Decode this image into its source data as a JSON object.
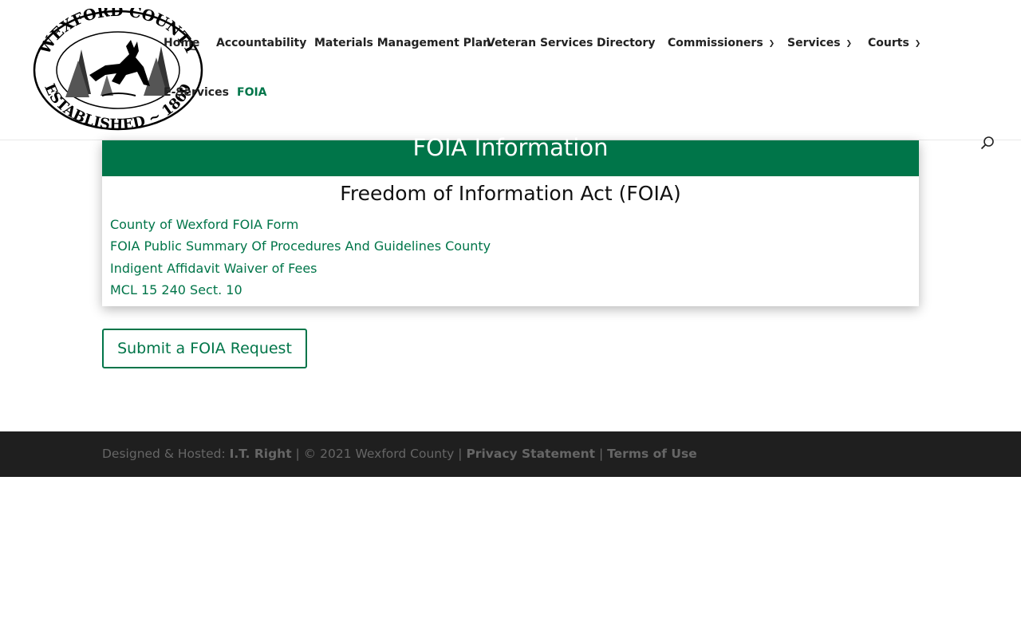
{
  "header": {
    "logo": {
      "top_text": "WEXFORD COUNTY",
      "bottom_text": "ESTABLISHED ~ 1869",
      "icon": "deer-seal-icon"
    },
    "nav": {
      "items": [
        {
          "label": "Home",
          "dropdown": false
        },
        {
          "label": "Accountability",
          "dropdown": false
        },
        {
          "label": "Materials Management Plan",
          "dropdown": false
        },
        {
          "label": "Veteran Services",
          "dropdown": false
        },
        {
          "label": "Directory",
          "dropdown": false
        },
        {
          "label": "Commissioners",
          "dropdown": true
        },
        {
          "label": "Services",
          "dropdown": true
        },
        {
          "label": "Courts",
          "dropdown": true
        },
        {
          "label": "E-Services",
          "dropdown": false
        },
        {
          "label": "FOIA",
          "dropdown": false,
          "active": true
        }
      ],
      "chevron": "chevron-down-icon"
    },
    "search_icon": "search-icon"
  },
  "main": {
    "banner_title": "FOIA Information",
    "section_title": "Freedom of Information Act (FOIA)",
    "links": [
      "County of Wexford FOIA Form",
      "FOIA Public Summary Of Procedures And Guidelines County",
      "Indigent Affidavit Waiver of Fees",
      "MCL 15 240 Sect. 10"
    ],
    "cta_label": "Submit a FOIA Request"
  },
  "footer": {
    "designed_label": "Designed & Hosted: ",
    "designer": "I.T. Right",
    "copyright": " | © 2021 Wexford County | ",
    "privacy": "Privacy Statement",
    "divider": " | ",
    "terms": "Terms of Use"
  },
  "colors": {
    "accent": "#007549",
    "footer_bg": "#1f1f1f",
    "footer_text": "#666666"
  }
}
